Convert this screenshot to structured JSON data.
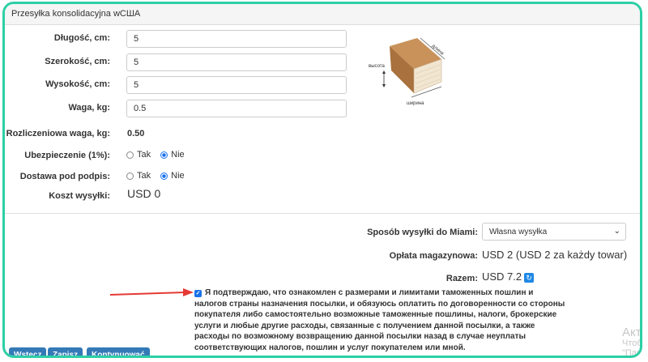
{
  "panel": {
    "title": "Przesyłka konsolidacyjna wСША"
  },
  "form": {
    "length_label": "Długość, cm:",
    "length_value": "5",
    "width_label": "Szerokość, cm:",
    "width_value": "5",
    "height_label": "Wysokość, cm:",
    "height_value": "5",
    "weight_label": "Waga, kg:",
    "weight_value": "0.5",
    "calc_weight_label": "Rozliczeniowa waga, kg:",
    "calc_weight_value": "0.50",
    "insurance_label": "Ubezpieczenie (1%):",
    "delivery_label": "Dostawa pod podpis:",
    "yes": "Tak",
    "no": "Nie",
    "cost_label": "Koszt wysyłki:",
    "cost_value": "USD 0"
  },
  "illustration": {
    "length": "длина",
    "height": "высота",
    "width": "ширина"
  },
  "shipping": {
    "method_label": "Sposób wysyłki do Miami:",
    "method_value": "Własna wysyłka",
    "storage_label": "Opłata magazynowa:",
    "storage_value": "USD 2 (USD 2 za każdy towar)",
    "total_label": "Razem:",
    "total_value": "USD 7.2"
  },
  "consent": {
    "checked": true,
    "text": "Я подтверждаю, что ознакомлен с размерами и лимитами таможенных пошлин и налогов страны назначения посылки, и обязуюсь оплатить по договоренности со стороны покупателя либо самостоятельно возможные таможенные пошлины, налоги, брокерские услуги и любые другие расходы, связанные с получением данной посылки, а также расходы по возможному возвращению данной посылки назад в случае неуплаты соответствующих налогов, пошлин и услуг покупателем или мной."
  },
  "buttons": {
    "back": "Wstecz",
    "save": "Zapisz",
    "continue": "Kontynuować"
  },
  "watermark": {
    "line1": "Акти",
    "line2": "Чтобы",
    "line3": "\"Пара"
  },
  "colors": {
    "frame": "#2ccfa5",
    "primary": "#337ab7",
    "arrow": "#e53935"
  }
}
